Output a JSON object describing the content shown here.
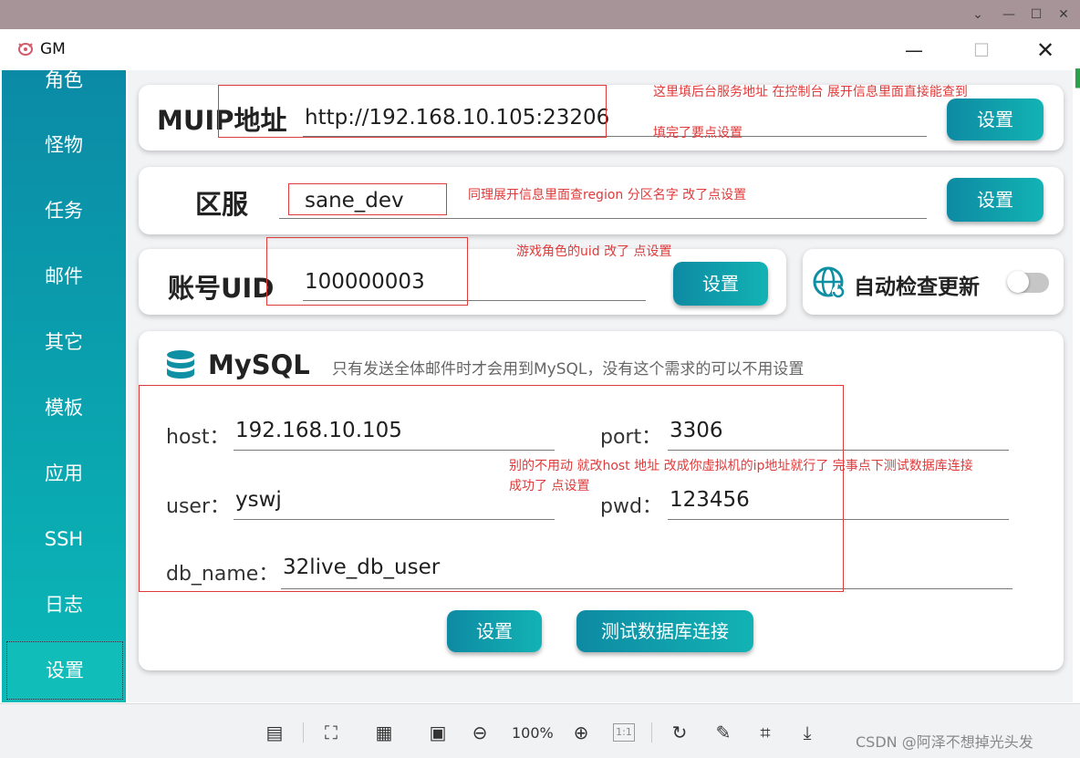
{
  "window": {
    "title": "GM"
  },
  "sidebar": {
    "items": [
      {
        "label": "角色"
      },
      {
        "label": "怪物"
      },
      {
        "label": "任务"
      },
      {
        "label": "邮件"
      },
      {
        "label": "其它"
      },
      {
        "label": "模板"
      },
      {
        "label": "应用"
      },
      {
        "label": "SSH"
      },
      {
        "label": "日志"
      },
      {
        "label": "设置"
      }
    ],
    "active_index": 9
  },
  "muip": {
    "label": "MUIP地址",
    "value": "http://192.168.10.105:23206",
    "button": "设置",
    "note_line1": "这里填后台服务地址 在控制台 展开信息里面直接能查到",
    "note_line2": "填完了要点设置"
  },
  "region": {
    "label": "区服",
    "value": "sane_dev",
    "button": "设置",
    "note": "同理展开信息里面查region 分区名字 改了点设置"
  },
  "uid": {
    "label": "账号UID",
    "value": "100000003",
    "button": "设置",
    "note": "游戏角色的uid 改了 点设置"
  },
  "auto_update": {
    "label": "自动检查更新",
    "enabled": false
  },
  "mysql": {
    "title": "MySQL",
    "subtitle": "只有发送全体邮件时才会用到MySQL，没有这个需求的可以不用设置",
    "host_label": "host：",
    "host_value": "192.168.10.105",
    "port_label": "port：",
    "port_value": "3306",
    "user_label": "user：",
    "user_value": "yswj",
    "pwd_label": "pwd：",
    "pwd_value": "123456",
    "dbname_label": "db_name：",
    "dbname_value": "32live_db_user",
    "set_button": "设置",
    "test_button": "测试数据库连接",
    "note_line1": "别的不用动 就改host 地址 改成你虚拟机的ip地址就行了  完事点下测试数据库连接",
    "note_line2": "成功了  点设置"
  },
  "toolbar": {
    "zoom": "100%",
    "one_to_one": "1:1"
  },
  "watermark": "CSDN @阿泽不想掉光头发",
  "colors": {
    "accent": "#0e8aa3",
    "accent_light": "#12b3b4",
    "annotation": "#e03a3a"
  }
}
